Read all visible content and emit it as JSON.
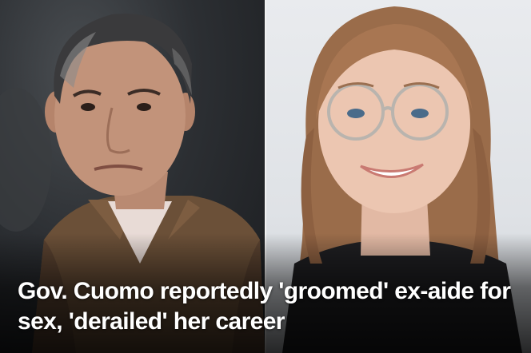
{
  "headline": "Gov. Cuomo reportedly 'groomed' ex-aide for sex, 'derailed' her career",
  "colors": {
    "headline_text": "#ffffff",
    "divider": "#f2f2f2",
    "left_background": "#2c2f33",
    "right_background": "#e3e6e9"
  }
}
